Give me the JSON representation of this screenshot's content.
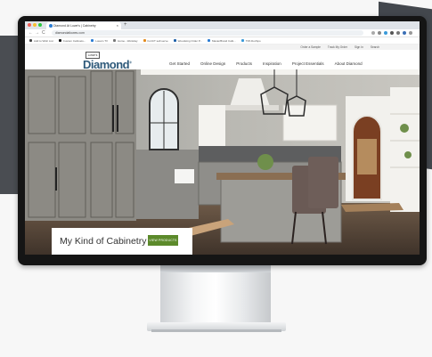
{
  "browser": {
    "tab_title": "Diamond At Lowe's | Cabinetry",
    "tab_close": "×",
    "new_tab": "+",
    "nav_back": "←",
    "nav_forward": "→",
    "nav_reload": "C",
    "url": "diamondatlowes.com",
    "bookmarks": [
      "Add to Wish List",
      "Custom Cabinets...",
      "Lowe's TV",
      "Home - Workday",
      "FortCT self-serve",
      "Woodwing Order P...",
      "MasterBrand Cabi...",
      "TPA DocSpo"
    ]
  },
  "site": {
    "utility_links": [
      "Order a Sample",
      "Track My Order",
      "Sign In",
      "Search"
    ],
    "retailer_logo": "Lowe's",
    "brand_name": "Diamond",
    "brand_mark": "®",
    "nav_items": [
      "Get Started",
      "Online Design",
      "Products",
      "Inspiration",
      "Project Essentials",
      "About Diamond"
    ],
    "hero_title": "My Kind of Cabinetry",
    "hero_button": "VIEW PRODUCTS"
  },
  "colors": {
    "brand_blue": "#2f5a7a",
    "button_green": "#5c8a2b"
  }
}
